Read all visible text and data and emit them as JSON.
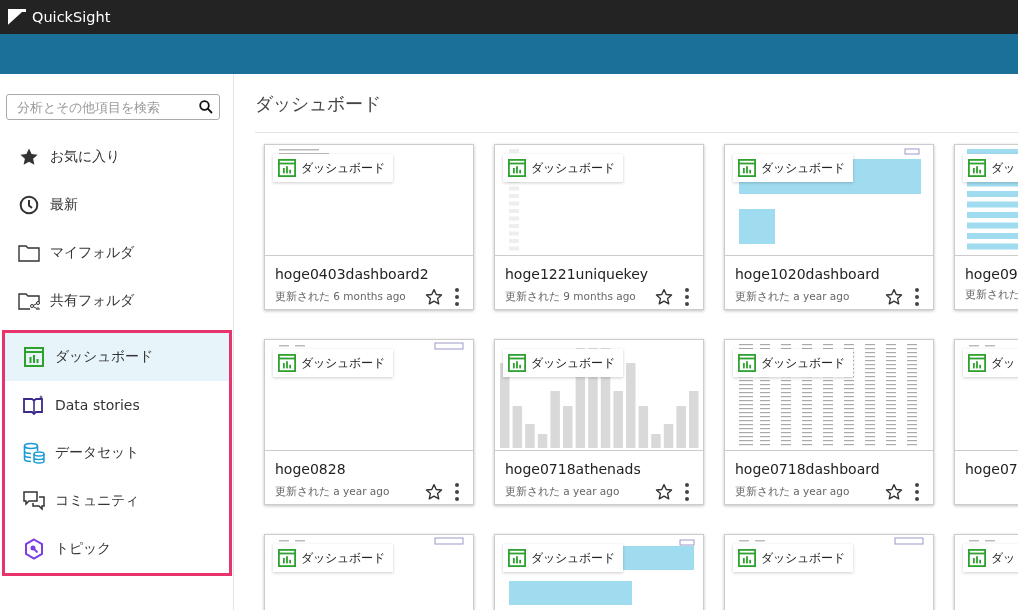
{
  "app": {
    "title": "QuickSight"
  },
  "sidebar": {
    "search": {
      "placeholder": "分析とその他項目を検索"
    },
    "items": [
      {
        "label": "お気に入り",
        "kind": "star",
        "selected": false
      },
      {
        "label": "最新",
        "kind": "clock",
        "selected": false
      },
      {
        "label": "マイフォルダ",
        "kind": "folder",
        "selected": false
      },
      {
        "label": "共有フォルダ",
        "kind": "shared-folder",
        "selected": false
      }
    ],
    "highlighted_items": [
      {
        "label": "ダッシュボード",
        "kind": "dashboard",
        "selected": true
      },
      {
        "label": "Data stories",
        "kind": "story",
        "selected": false
      },
      {
        "label": "データセット",
        "kind": "dataset",
        "selected": false
      },
      {
        "label": "コミュニティ",
        "kind": "community",
        "selected": false
      },
      {
        "label": "トピック",
        "kind": "topic",
        "selected": false
      }
    ]
  },
  "main": {
    "heading": "ダッシュボード",
    "cards": [
      {
        "badge": "ダッシュボード",
        "kind": "text-rows",
        "name": "hoge0403dashboard2",
        "updated": "更新された 6 months ago",
        "favorite": false
      },
      {
        "badge": "ダッシュボード",
        "kind": "list",
        "name": "hoge1221uniquekey",
        "updated": "更新された 9 months ago",
        "favorite": false
      },
      {
        "badge": "ダッシュボード",
        "kind": "blue-blocks",
        "name": "hoge1020dashboard",
        "updated": "更新された a year ago",
        "favorite": false
      },
      {
        "badge": "ダッ",
        "kind": "stripes",
        "name": "hoge09",
        "updated": "更新された"
      },
      {
        "badge": "ダッシュボード",
        "kind": "blank",
        "name": "hoge0828",
        "updated": "更新された a year ago",
        "favorite": false
      },
      {
        "badge": "ダッシュボード",
        "kind": "columns",
        "name": "hoge0718athenads",
        "updated": "更新された a year ago",
        "favorite": false
      },
      {
        "badge": "ダッシュボード",
        "kind": "table",
        "name": "hoge0718dashboard",
        "updated": "更新された a year ago",
        "favorite": false
      },
      {
        "badge": "ダッ",
        "kind": "blank",
        "name": "hoge07"
      },
      {
        "badge": "ダッシュボード",
        "kind": "blank"
      },
      {
        "badge": "ダッシュボード",
        "kind": "blue-bars"
      },
      {
        "badge": "ダッシュボード",
        "kind": "blank"
      },
      {
        "badge": "ダッ",
        "kind": "blank"
      }
    ]
  }
}
